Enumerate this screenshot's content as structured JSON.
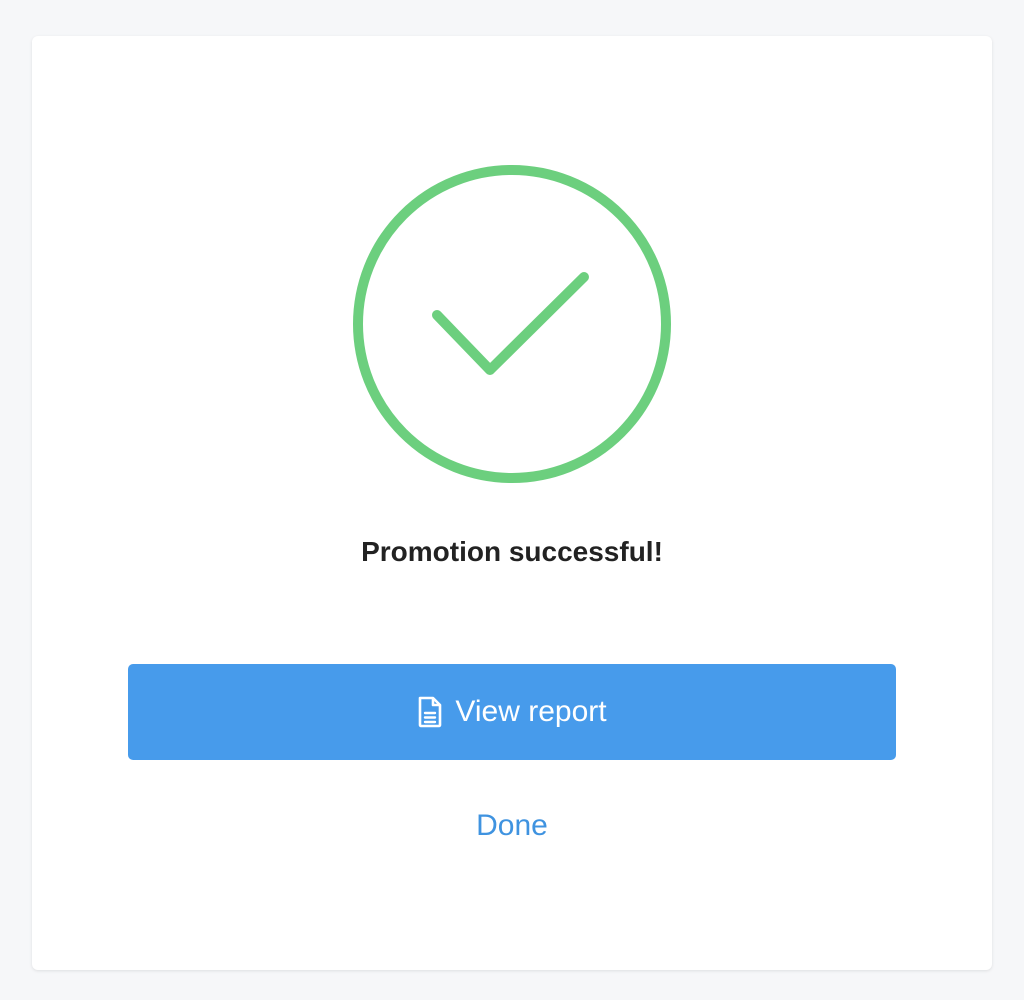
{
  "dialog": {
    "message": "Promotion successful!",
    "primary_button": {
      "label": "View report",
      "icon": "document-icon"
    },
    "secondary_button": {
      "label": "Done"
    }
  },
  "icons": {
    "success": "check-circle-icon"
  },
  "colors": {
    "success": "#6ccf7e",
    "primary": "#479beb",
    "link": "#3f93e0",
    "text": "#222222",
    "background": "#f6f7f9",
    "card": "#ffffff"
  }
}
